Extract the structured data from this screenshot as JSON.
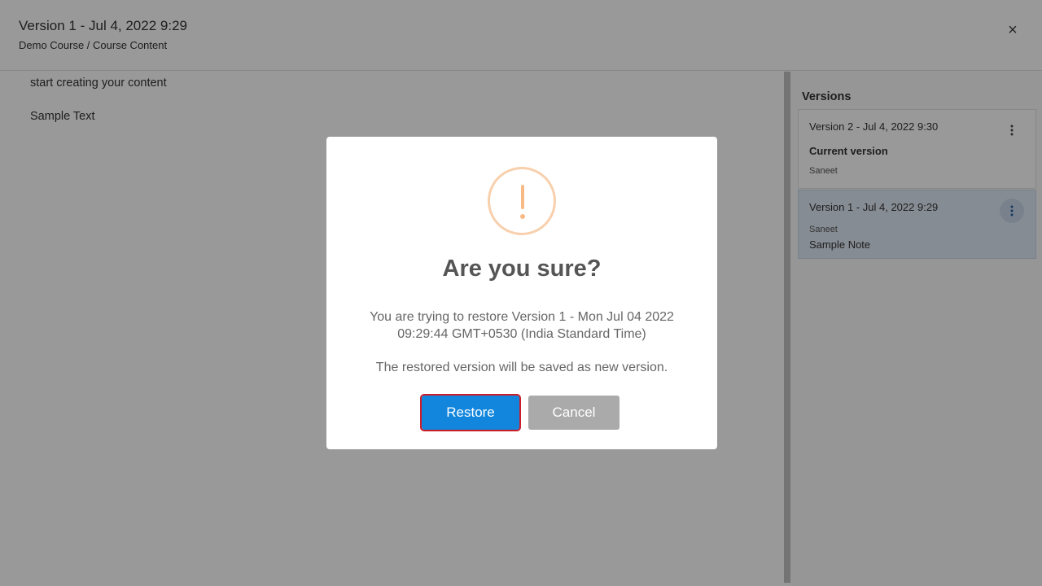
{
  "header": {
    "title": "Version 1 - Jul 4, 2022 9:29",
    "subtitle": "Demo Course / Course Content",
    "close_icon": "×"
  },
  "content": {
    "lines": [
      "start creating your content",
      "Sample Text"
    ]
  },
  "versions": {
    "heading": "Versions",
    "items": [
      {
        "title": "Version 2 - Jul 4, 2022 9:30",
        "status": "Current version",
        "author": "Saneet"
      },
      {
        "title": "Version 1 - Jul 4, 2022 9:29",
        "author": "Saneet",
        "note": "Sample Note"
      }
    ]
  },
  "dialog": {
    "icon": "warning-icon",
    "title": "Are you sure?",
    "message_line1": "You are trying to restore Version 1 - Mon Jul 04 2022 09:29:44 GMT+0530 (India Standard Time)",
    "message_line2": "The restored version will be saved as new version.",
    "restore_label": "Restore",
    "cancel_label": "Cancel"
  },
  "colors": {
    "restore_button": "#1286dd",
    "cancel_button": "#aaaaaa",
    "warning_icon": "#f8bb86",
    "selected_version": "#dfe9f5"
  }
}
